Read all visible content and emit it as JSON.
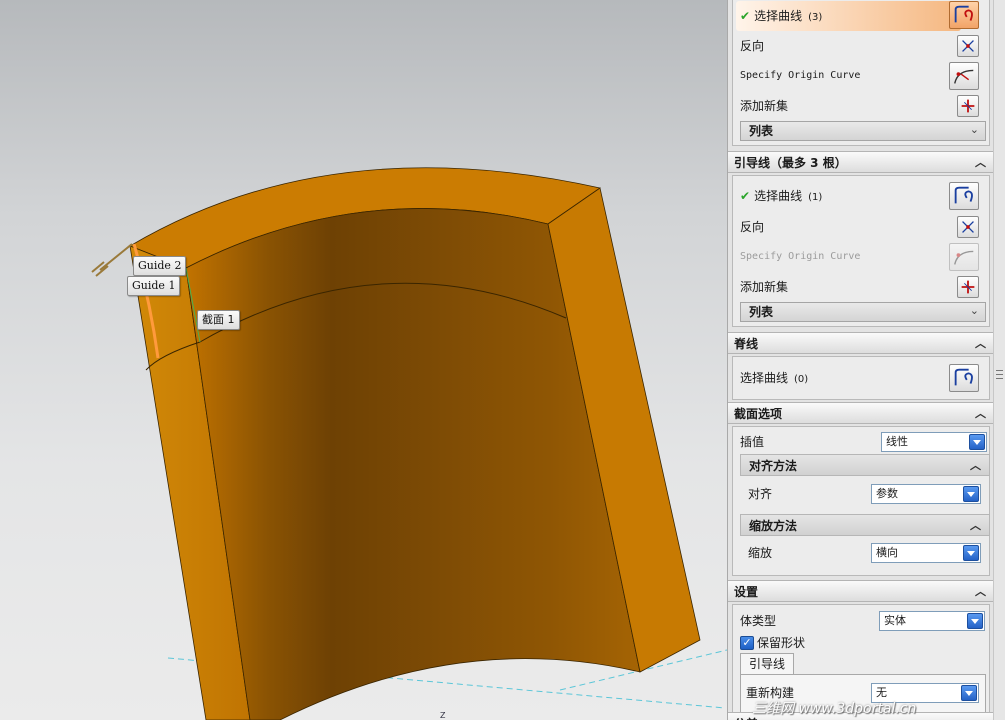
{
  "viewport": {
    "label_guide2": "Guide 2",
    "label_guide1": "Guide 1",
    "label_section": "截面 1",
    "axis_label": "Z",
    "body_color": "#c97a00",
    "shade_color": "#7a4a06"
  },
  "section_group": {
    "select_curve": {
      "label": "选择曲线",
      "count": "(3)",
      "icon": "select-curve-icon"
    },
    "reverse": {
      "label": "反向",
      "icon": "reverse-direction-icon"
    },
    "origin": {
      "label": "Specify Origin Curve",
      "icon": "origin-curve-icon"
    },
    "add_new": {
      "label": "添加新集",
      "icon": "add-set-icon"
    },
    "list": {
      "label": "列表"
    }
  },
  "guide": {
    "header": "引导线（最多 3 根）",
    "select_curve": {
      "label": "选择曲线",
      "count": "(1)"
    },
    "reverse": {
      "label": "反向"
    },
    "origin": {
      "label": "Specify Origin Curve"
    },
    "add_new": {
      "label": "添加新集"
    },
    "list": {
      "label": "列表"
    }
  },
  "spine": {
    "header": "脊线",
    "select_curve": {
      "label": "选择曲线",
      "count": "(0)"
    }
  },
  "section_options": {
    "header": "截面选项",
    "interp": {
      "label": "插值",
      "value": "线性"
    },
    "align_method": {
      "header": "对齐方法",
      "label": "对齐",
      "value": "参数"
    },
    "scale_method": {
      "header": "缩放方法",
      "label": "缩放",
      "value": "横向"
    }
  },
  "settings": {
    "header": "设置",
    "body_type": {
      "label": "体类型",
      "value": "实体"
    },
    "keep_shape": {
      "label": "保留形状",
      "checked": true
    },
    "tab": "引导线",
    "rebuild": {
      "label": "重新构建",
      "value": "无"
    },
    "next_header": "公差"
  },
  "watermark": "三维网 www.3dportal.cn",
  "colors": {
    "accent_orange": "#f2a468",
    "dropdown_blue": "#2462c6",
    "check_green": "#2aa52a"
  }
}
